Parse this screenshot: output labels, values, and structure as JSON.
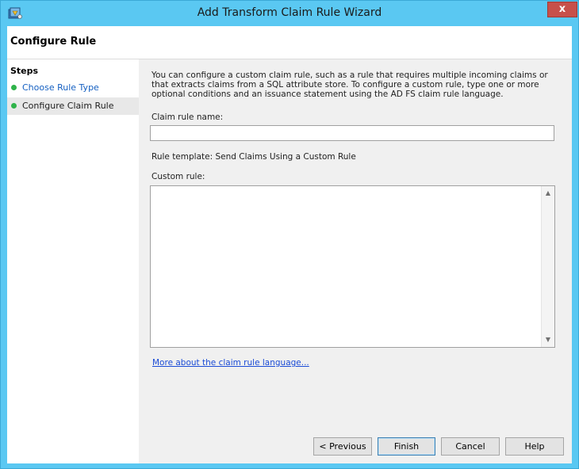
{
  "window": {
    "title": "Add Transform Claim Rule Wizard",
    "close_glyph": "x",
    "icon": "wizard-app-icon"
  },
  "header": {
    "title": "Configure Rule"
  },
  "steps": {
    "heading": "Steps",
    "items": [
      {
        "label": "Choose Rule Type",
        "state": "link"
      },
      {
        "label": "Configure Claim Rule",
        "state": "current"
      }
    ]
  },
  "content": {
    "description": "You can configure a custom claim rule, such as a rule that requires multiple incoming claims or that extracts claims from a SQL attribute store. To configure a custom rule, type one or more optional conditions and an issuance statement using the AD FS claim rule language.",
    "claim_rule_name_label": "Claim rule name:",
    "claim_rule_name_value": "",
    "rule_template_text": "Rule template: Send Claims Using a Custom Rule",
    "custom_rule_label": "Custom rule:",
    "custom_rule_value": "",
    "more_link": "More about the claim rule language..."
  },
  "buttons": {
    "previous": "< Previous",
    "finish": "Finish",
    "cancel": "Cancel",
    "help": "Help"
  },
  "colors": {
    "title_bar": "#5ac8f2",
    "step_dot": "#2fb34a",
    "link": "#1a4bd6",
    "close_button": "#c7504a"
  }
}
